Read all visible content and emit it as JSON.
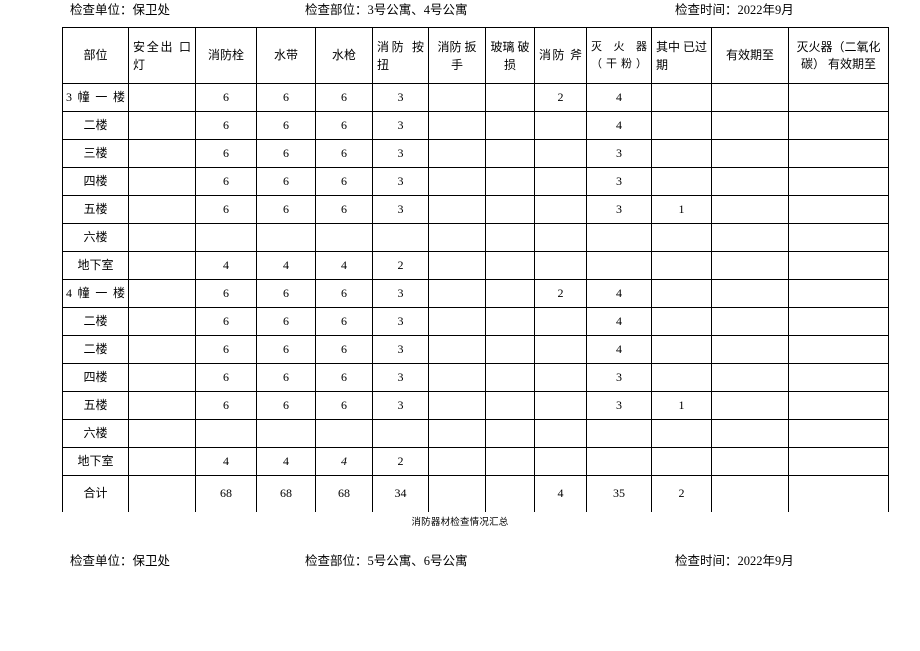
{
  "document": {
    "subtitle": "消防器材检查情况汇总"
  },
  "header_top": {
    "unit_label": "检查单位：保卫处",
    "place_label": "检查部位：3号公寓、4号公寓",
    "time_label": "检查时间：2022年9月"
  },
  "header_bottom": {
    "unit_label": "检查单位：保卫处",
    "place_label": "检查部位：5号公寓、6号公寓",
    "time_label": "检查时间：2022年9月"
  },
  "table": {
    "columns": [
      {
        "label": "部位"
      },
      {
        "label": "安全出 口灯"
      },
      {
        "label": "消防栓"
      },
      {
        "label": "水带"
      },
      {
        "label": "水枪"
      },
      {
        "label": "消防 按扭"
      },
      {
        "label": "消防 扳手"
      },
      {
        "label": "玻璃 破损"
      },
      {
        "label": "消防 斧"
      },
      {
        "label": "灭火器 （干粉）"
      },
      {
        "label": "其中 已过期"
      },
      {
        "label": "有效期至"
      },
      {
        "label": "灭火器（二氧化碳） 有效期至"
      }
    ],
    "rows": [
      {
        "label": "3幢一楼",
        "cells": [
          "",
          "6",
          "6",
          "6",
          "3",
          "",
          "",
          "2",
          "4",
          "",
          "",
          ""
        ]
      },
      {
        "label": "二楼",
        "cells": [
          "",
          "6",
          "6",
          "6",
          "3",
          "",
          "",
          "",
          "4",
          "",
          "",
          ""
        ]
      },
      {
        "label": "三楼",
        "cells": [
          "",
          "6",
          "6",
          "6",
          "3",
          "",
          "",
          "",
          "3",
          "",
          "",
          ""
        ]
      },
      {
        "label": "四楼",
        "cells": [
          "",
          "6",
          "6",
          "6",
          "3",
          "",
          "",
          "",
          "3",
          "",
          "",
          ""
        ]
      },
      {
        "label": "五楼",
        "cells": [
          "",
          "6",
          "6",
          "6",
          "3",
          "",
          "",
          "",
          "3",
          "1",
          "",
          ""
        ]
      },
      {
        "label": "六楼",
        "cells": [
          "",
          "",
          "",
          "",
          "",
          "",
          "",
          "",
          "",
          "",
          "",
          ""
        ]
      },
      {
        "label": "地下室",
        "cells": [
          "",
          "4",
          "4",
          "4",
          "2",
          "",
          "",
          "",
          "",
          "",
          "",
          ""
        ]
      },
      {
        "label": "4幢一楼",
        "cells": [
          "",
          "6",
          "6",
          "6",
          "3",
          "",
          "",
          "2",
          "4",
          "",
          "",
          ""
        ]
      },
      {
        "label": "二楼",
        "cells": [
          "",
          "6",
          "6",
          "6",
          "3",
          "",
          "",
          "",
          "4",
          "",
          "",
          ""
        ]
      },
      {
        "label": "二楼",
        "cells": [
          "",
          "6",
          "6",
          "6",
          "3",
          "",
          "",
          "",
          "4",
          "",
          "",
          ""
        ]
      },
      {
        "label": "四楼",
        "cells": [
          "",
          "6",
          "6",
          "6",
          "3",
          "",
          "",
          "",
          "3",
          "",
          "",
          ""
        ]
      },
      {
        "label": "五楼",
        "cells": [
          "",
          "6",
          "6",
          "6",
          "3",
          "",
          "",
          "",
          "3",
          "1",
          "",
          ""
        ]
      },
      {
        "label": "六楼",
        "cells": [
          "",
          "",
          "",
          "",
          "",
          "",
          "",
          "",
          "",
          "",
          "",
          ""
        ]
      },
      {
        "label": "地下室",
        "cells": [
          "",
          "4",
          "4",
          "4",
          "2",
          "",
          "",
          "",
          "",
          "",
          "",
          ""
        ]
      }
    ],
    "total_row": {
      "label": "合计",
      "cells": [
        "",
        "68",
        "68",
        "68",
        "34",
        "",
        "",
        "4",
        "35",
        "2",
        "",
        ""
      ]
    }
  }
}
